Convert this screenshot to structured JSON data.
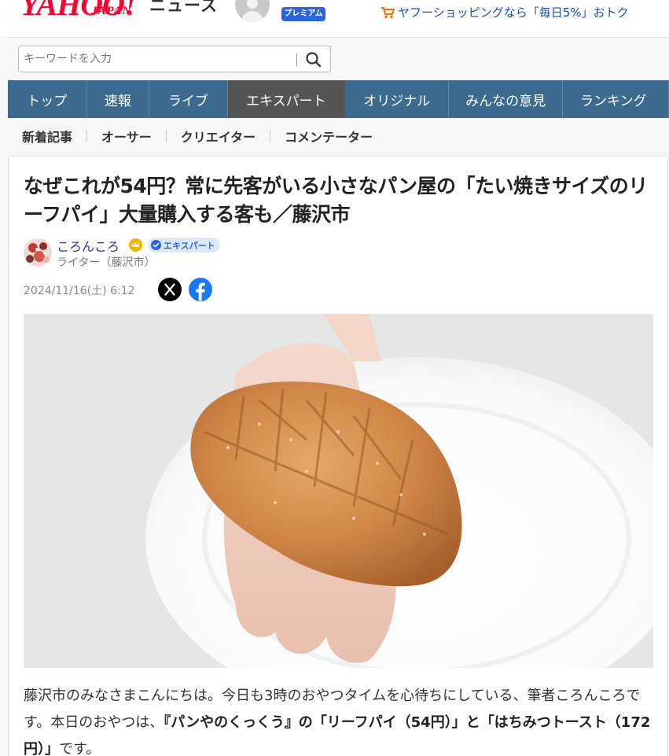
{
  "header": {
    "logo_text": "YAHOO!",
    "logo_sub": "JAPAN",
    "section": "ニュース",
    "premium_badge": "プレミアム",
    "shopping_promo": "ヤフーショッピングなら「毎日5%」おトク"
  },
  "search": {
    "placeholder": "キーワードを入力",
    "button_icon": "search-icon"
  },
  "main_nav": {
    "tabs": [
      {
        "label": "トップ",
        "active": false
      },
      {
        "label": "速報",
        "active": false
      },
      {
        "label": "ライブ",
        "active": false
      },
      {
        "label": "エキスパート",
        "active": true
      },
      {
        "label": "オリジナル",
        "active": false
      },
      {
        "label": "みんなの意見",
        "active": false
      },
      {
        "label": "ランキング",
        "active": false
      }
    ]
  },
  "sub_nav": {
    "items": [
      "新着記事",
      "オーサー",
      "クリエイター",
      "コメンテーター"
    ]
  },
  "article": {
    "title": "なぜこれが54円？常に先客がいる小さなパン屋の「たい焼きサイズのリーフパイ」大量購入する客も／藤沢市",
    "author": {
      "name": "ころんころ",
      "badge": "エキスパート",
      "role": "ライター（藤沢市）"
    },
    "date": "2024/11/16(土) 6:12",
    "share": [
      "x-icon",
      "facebook-icon"
    ],
    "body": {
      "p1_start": "藤沢市のみなさまこんにちは。今日も3時のおやつタイムを心待ちにしている、筆者ころんころです。本日のおやつは、",
      "p1_bold": "『パンやのくっくう』の「リーフパイ（54円）」と「はちみつトースト（172円）」",
      "p1_end": "です。"
    }
  },
  "colors": {
    "yahoo_red": "#ff0033",
    "nav_blue": "#3d6b8f",
    "nav_active": "#555555",
    "link_blue": "#1b4fa8",
    "author_purple": "#3b2e8a"
  }
}
